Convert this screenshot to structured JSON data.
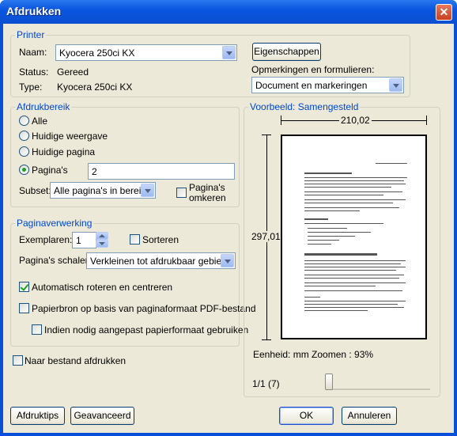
{
  "window": {
    "title": "Afdrukken"
  },
  "printer": {
    "group_title": "Printer",
    "name_label": "Naam:",
    "name_value": "Kyocera 250ci KX",
    "properties_button": "Eigenschappen",
    "status_label": "Status:",
    "status_value": "Gereed",
    "type_label": "Type:",
    "type_value": "Kyocera 250ci KX",
    "comments_label": "Opmerkingen en formulieren:",
    "comments_value": "Document en markeringen"
  },
  "range": {
    "group_title": "Afdrukbereik",
    "all": "Alle",
    "current_view": "Huidige weergave",
    "current_page": "Huidige pagina",
    "pages": "Pagina's",
    "pages_value": "2",
    "subset_label": "Subset:",
    "subset_value": "Alle pagina's in bereik",
    "reverse_line1": "Pagina's",
    "reverse_line2": "omkeren"
  },
  "handling": {
    "group_title": "Paginaverwerking",
    "copies_label": "Exemplaren:",
    "copies_value": "1",
    "collate": "Sorteren",
    "scaling_label": "Pagina's schalen:",
    "scaling_value": "Verkleinen tot afdrukbaar gebied",
    "autorotate": "Automatisch roteren en centreren",
    "paper_source": "Papierbron op basis van paginaformaat PDF-bestand",
    "custom_paper": "Indien nodig aangepast papierformaat gebruiken"
  },
  "print_to_file": "Naar bestand afdrukken",
  "preview": {
    "group_title": "Voorbeeld: Samengesteld",
    "width": "210,02",
    "height": "297,01",
    "units": "Eenheid: mm Zoomen :  93%",
    "page_counter": "1/1 (7)"
  },
  "buttons": {
    "tips": "Afdruktips",
    "advanced": "Geavanceerd",
    "ok": "OK",
    "cancel": "Annuleren"
  }
}
